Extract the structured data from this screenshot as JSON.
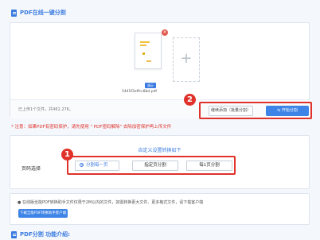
{
  "header": {
    "title": "PDF在线一键分割"
  },
  "upload": {
    "file_name": "5445f3effcc8bd.pdf",
    "badge": "演示",
    "close_symbol": "×",
    "add_symbol": "+",
    "status": "已上传1个文件，共461.27K。"
  },
  "actions": {
    "add_label": "继续添加（批量分割）",
    "start_label": "开始分割",
    "start_icon": "⇆"
  },
  "markers": {
    "one": "1",
    "two": "2"
  },
  "notice": "* 注意：如果PDF有密码保护，请先使用 \" PDF密码解除\" 去除加密保护再上传文件",
  "settings": {
    "title": "自定义设置转换如下",
    "row_label": "页码选择",
    "options": [
      "分割每一页",
      "指定页分割",
      "每1页分割"
    ],
    "selected_index": 0
  },
  "client": {
    "text": "● 在线版全能PDF转换助手文件仅限于2M以内的文件，如需转换更大文件、更多格式文件，请下载客户端",
    "button_label": "下载全能PDF转换助手客户端"
  },
  "footer": {
    "title": "PDF分割 功能介绍:"
  },
  "colors": {
    "accent": "#3a7be0",
    "highlight": "#e0312a"
  }
}
